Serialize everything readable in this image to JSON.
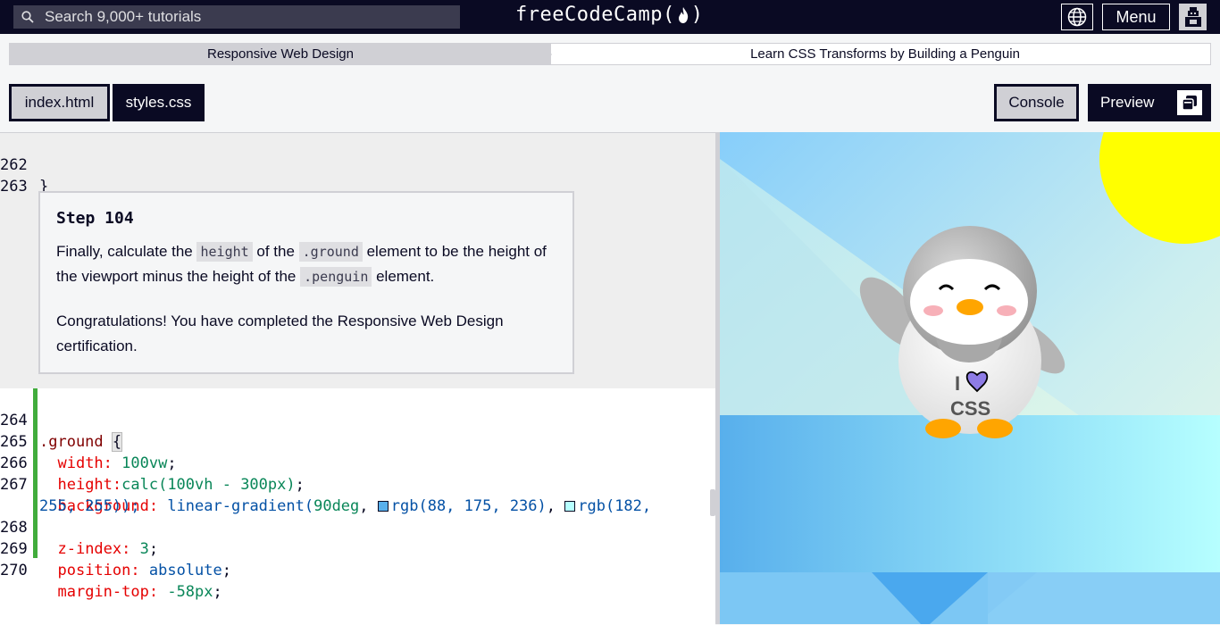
{
  "nav": {
    "search_placeholder": "Search 9,000+ tutorials",
    "brand": "freeCodeCamp",
    "menu_label": "Menu"
  },
  "breadcrumb": {
    "cert": "Responsive Web Design",
    "project": "Learn CSS Transforms by Building a Penguin"
  },
  "tabs": {
    "file1": "index.html",
    "file2": "styles.css",
    "console": "Console",
    "preview": "Preview"
  },
  "editor": {
    "top_lines": [
      {
        "n": "262",
        "text": "}"
      },
      {
        "n": "263",
        "text": ""
      }
    ],
    "step": {
      "title": "Step 104",
      "p1_a": "Finally, calculate the ",
      "p1_code1": "height",
      "p1_b": " of the ",
      "p1_code2": ".ground",
      "p1_c": " element to be the height of the viewport minus the height of the ",
      "p1_code3": ".penguin",
      "p1_d": " element.",
      "p2": "Congratulations! You have completed the Responsive Web Design certification."
    },
    "code_lines": [
      {
        "n": "264",
        "sel": ".ground",
        "brace": "{"
      },
      {
        "n": "265",
        "prop": "width:",
        "val": "100vw"
      },
      {
        "n": "266",
        "prop": "height:",
        "val": "calc(100vh - 300px)"
      },
      {
        "n": "267",
        "prop": "background:",
        "val1": "linear-gradient(",
        "val2": "90deg",
        "c1": "rgb(88, 175, 236)",
        "c2a": "rgb(182,",
        "c2b": "255, 255));"
      },
      {
        "n": "268",
        "prop": "z-index:",
        "val": "3"
      },
      {
        "n": "269",
        "prop": "position:",
        "val": "absolute"
      },
      {
        "n": "270",
        "prop": "margin-top:",
        "val": "-58px"
      }
    ]
  },
  "preview": {
    "shirt_text1": "I",
    "shirt_text2": "CSS"
  },
  "colors": {
    "nav_bg": "#0a0a23",
    "code_bar": "#41ac3c",
    "swatch1": "#58afec",
    "swatch2": "#b6ffff",
    "sun": "#ffff00"
  }
}
